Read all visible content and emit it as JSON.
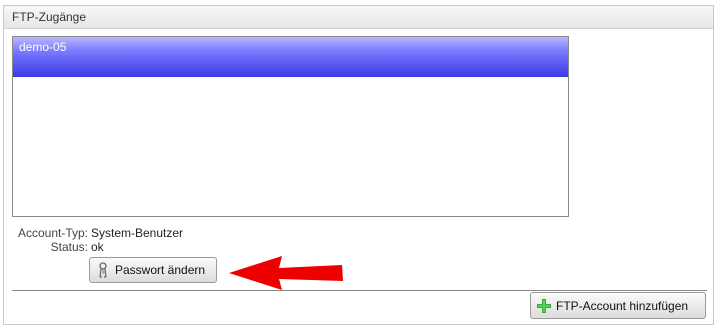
{
  "panel": {
    "title": "FTP-Zugänge"
  },
  "ftp_list": {
    "items": [
      {
        "label": "demo-05",
        "selected": true
      }
    ]
  },
  "details": {
    "account_type_label": "Account-Typ:",
    "account_type_value": "System-Benutzer",
    "status_label": "Status:",
    "status_value": "ok"
  },
  "buttons": {
    "change_password": "Passwort ändern",
    "add_ftp_account": "FTP-Account hinzufügen"
  },
  "icons": {
    "change_password": "key-user-icon",
    "add_ftp_account": "plus-icon",
    "annotation": "red-arrow-icon"
  },
  "colors": {
    "selection": "#3a3ae6",
    "annotation_arrow": "#ee0000",
    "add_icon": "#2fa52f"
  }
}
